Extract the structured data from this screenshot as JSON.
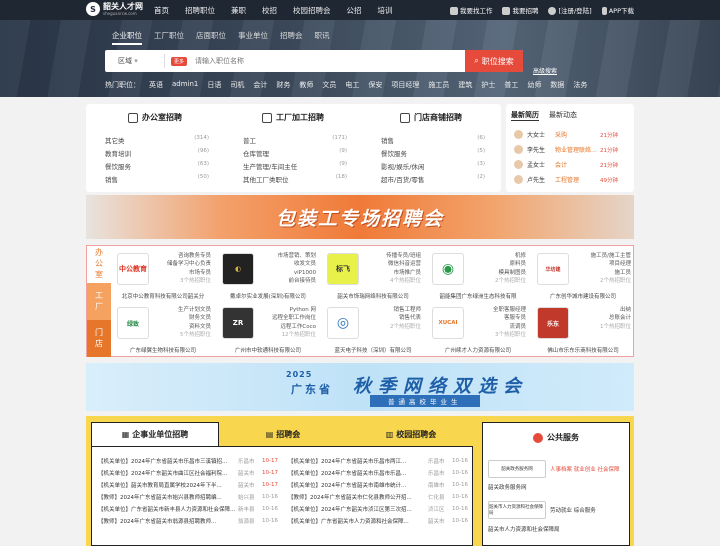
{
  "topbar": {
    "logo_name": "韶关人才网",
    "logo_sub": "sheguanrcw.com",
    "nav": [
      "首页",
      "招聘职位",
      "兼职",
      "校招",
      "校园招聘会",
      "公招",
      "培训"
    ],
    "right": [
      "我要找工作",
      "我要招聘",
      "[注册/登陆]",
      "APP下载"
    ]
  },
  "search": {
    "tabs": [
      "企业职位",
      "工厂职位",
      "店面职位",
      "事业单位",
      "招聘会",
      "职讯"
    ],
    "region": "区域",
    "more": "更多",
    "placeholder": "请输入职位名称",
    "button": "职位搜索",
    "advanced": "高级搜索",
    "hot_label": "热门职位：",
    "hot": [
      "英语",
      "admin1",
      "日语",
      "司机",
      "会计",
      "财务",
      "教师",
      "文员",
      "电工",
      "保安",
      "项目经理",
      "施工员",
      "建筑",
      "护士",
      "普工",
      "幼师",
      "数据",
      "法务"
    ]
  },
  "categories": [
    {
      "title": "办公室招聘",
      "rows": [
        [
          "其它类",
          "(314)"
        ],
        [
          "教育培训",
          "(96)"
        ],
        [
          "餐饮服务",
          "(63)"
        ],
        [
          "销售",
          "(50)"
        ]
      ]
    },
    {
      "title": "工厂加工招聘",
      "rows": [
        [
          "普工",
          "(171)"
        ],
        [
          "仓库管理",
          "(9)"
        ],
        [
          "生产管理/车间主任",
          "(9)"
        ],
        [
          "其他工厂类职位",
          "(18)"
        ]
      ]
    },
    {
      "title": "门店商铺招聘",
      "rows": [
        [
          "销售",
          "(6)"
        ],
        [
          "餐饮服务",
          "(5)"
        ],
        [
          "影视/娱乐/休闲",
          "(3)"
        ],
        [
          "超市/百货/零售",
          "(2)"
        ]
      ]
    }
  ],
  "news": {
    "tabs": [
      "最新简历",
      "最新动态"
    ],
    "rows": [
      {
        "name": "大女士",
        "job": "采购",
        "time": "21分钟"
      },
      {
        "name": "李先生",
        "job": "物业管理联络...",
        "time": "21分钟"
      },
      {
        "name": "孟女士",
        "job": "会计",
        "time": "21分钟"
      },
      {
        "name": "卢先生",
        "job": "工程管理",
        "time": "49分钟"
      }
    ]
  },
  "banner1": {
    "text": "包装工专场招聘会"
  },
  "companies": {
    "side": [
      "办公室",
      "工厂",
      "门店"
    ],
    "cells": [
      {
        "logo": "中公教育",
        "jobs": [
          "咨询教务专员",
          "储备学习中心负责",
          "市场专员",
          "3个热招职位"
        ],
        "name": "北京中公教育科技有限公司韶关分"
      },
      {
        "logo": "◐",
        "jobs": [
          "市场营销、策划",
          "收发文员",
          "viP1000",
          "前台接待员"
        ],
        "name": "戴卓尔实业发展(深圳)有限公司"
      },
      {
        "logo": "标飞",
        "jobs": [
          "传播专员/班组",
          "微信抖音运营",
          "市场推广员",
          "4个热招职位"
        ],
        "name": "韶关市饰瑞网络科技有限公司"
      },
      {
        "logo": "◉",
        "jobs": [
          "机修",
          "原料员",
          "模具制图员",
          "2个热招职位"
        ],
        "name": "韶能集团广东绿洲生态科技有限"
      },
      {
        "logo": "华坊建",
        "jobs": [
          "施工员/施工主管",
          "项目经理",
          "施工员",
          "2个热招职位"
        ],
        "name": "广东创华城市建设有限公司"
      },
      {
        "logo": "绿致",
        "jobs": [
          "生产计划文员",
          "财务文员",
          "资料文员",
          "5个热招职位"
        ],
        "name": "广东绿翼生物科技有限公司"
      },
      {
        "logo": "ZR",
        "jobs": [
          "Python 网",
          "远程全职工作岗位",
          "远程工作Coco",
          "12个热招职位"
        ],
        "name": "广州市中软通科技有限公司"
      },
      {
        "logo": "◎",
        "jobs": [
          "销售工程师",
          "销售代表",
          "2个热招职位",
          ""
        ],
        "name": "蓝天电子科技（深圳）有限公司"
      },
      {
        "logo": "XUCAI",
        "jobs": [
          "全职客服经理",
          "客服专员",
          "流调员",
          "3个热招职位"
        ],
        "name": "广州续才人力资源有限公司"
      },
      {
        "logo": "乐东",
        "jobs": [
          "出纳",
          "总账会计",
          "1个热招职位",
          ""
        ],
        "name": "佛山市乐东乐商科技有限公司"
      }
    ]
  },
  "banner2": {
    "year": "2025",
    "region": "广东省",
    "title": "秋季网络双选会",
    "sub": "普通高校毕业生"
  },
  "bottom": {
    "tabs": [
      "企事业单位招聘",
      "招聘会",
      "校园招聘会"
    ],
    "left": [
      {
        "text": "【机关单位】2024年广东省韶关市乐昌市三溪镇招...",
        "place": "乐昌市",
        "date": "10-17"
      },
      {
        "text": "【机关单位】2024年广东韶关市曲江区社会福利院...",
        "place": "韶关市",
        "date": "10-17"
      },
      {
        "text": "【机关单位】韶关市教育局直属学校2024年下半...",
        "place": "韶关市",
        "date": "10-17"
      },
      {
        "text": "【教师】2024年广东省韶关市始兴县教师招聘编...",
        "place": "始兴县",
        "date": "10-16"
      },
      {
        "text": "【机关单位】广东省韶关市新丰县人力资源和社会保障...",
        "place": "新丰县",
        "date": "10-16"
      },
      {
        "text": "【教师】2024年广东省韶关市翁源县招聘教师...",
        "place": "翁源县",
        "date": "10-16"
      }
    ],
    "right": [
      {
        "text": "【机关单位】2024年广东省韶关市乐昌市两江...",
        "place": "乐昌市",
        "date": "10-16"
      },
      {
        "text": "【机关单位】2024年广东省韶关市乐昌市乐昌...",
        "place": "乐昌市",
        "date": "10-16"
      },
      {
        "text": "【机关单位】2024年广东省韶关市南雄市统计...",
        "place": "南雄市",
        "date": "10-16"
      },
      {
        "text": "【教师】2024年广东省韶关市仁化县教师公开招...",
        "place": "仁化县",
        "date": "10-16"
      },
      {
        "text": "【机关单位】2024年广东韶关市浈江区第三次招...",
        "place": "浈江区",
        "date": "10-16"
      },
      {
        "text": "【机关单位】广东省韶关市人力资源和社会保障...",
        "place": "韶关市",
        "date": "10-16"
      }
    ],
    "public": {
      "title": "公共服务",
      "rows": [
        {
          "box": "韶关政务服务网",
          "label": "人事档案 就业创业 社会保障"
        },
        {
          "box": "韶关政务服务网",
          "label": "韶关政务服务网"
        },
        {
          "box": "韶关市人力资源和社会保障局",
          "label": "劳动就业 综合服务"
        },
        {
          "box": "",
          "label": "韶关市人力资源和社会保障局"
        }
      ]
    }
  }
}
